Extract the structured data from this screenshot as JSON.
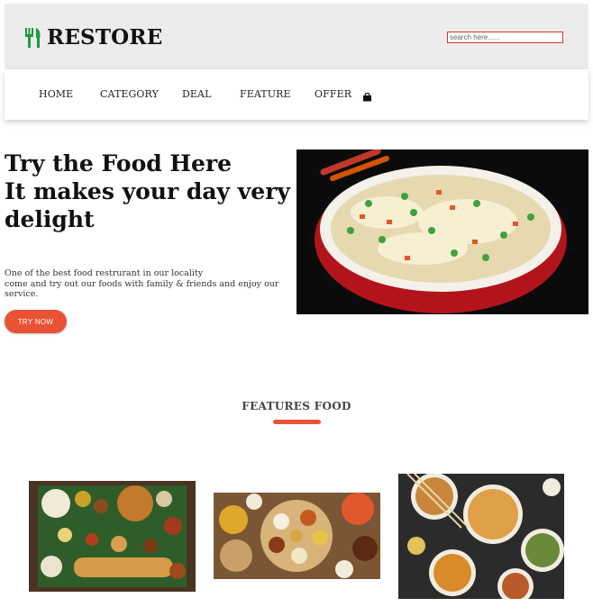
{
  "brand": {
    "name": "RESTORE",
    "logo_icon": "fork-knife-icon",
    "logo_color": "#1f9a3c"
  },
  "search": {
    "placeholder": "search here......"
  },
  "nav": {
    "items": [
      {
        "label": "HOME"
      },
      {
        "label": "CATEGORY"
      },
      {
        "label": "DEAL"
      },
      {
        "label": "FEATURE"
      },
      {
        "label": "OFFER"
      }
    ],
    "cart_icon": "shopping-bag-icon"
  },
  "hero": {
    "title_lines": [
      "Try the Food Here",
      "It makes your day very",
      "delight"
    ],
    "description_lines": [
      "One of the best food restrurant in our locality",
      "come and try out our foods with family & friends and enjoy our",
      "service."
    ],
    "button_label": "TRY NOW",
    "image": "fried-rice-bowl-photo"
  },
  "features": {
    "title": "FEATURES FOOD",
    "items": [
      {
        "image": "south-indian-thali-dosa-photo"
      },
      {
        "image": "indian-platter-thali-photo"
      },
      {
        "image": "noodle-bowls-photo"
      }
    ]
  },
  "colors": {
    "accent": "#ea5236",
    "header_bg": "#ececec",
    "search_border": "#e0322a"
  }
}
